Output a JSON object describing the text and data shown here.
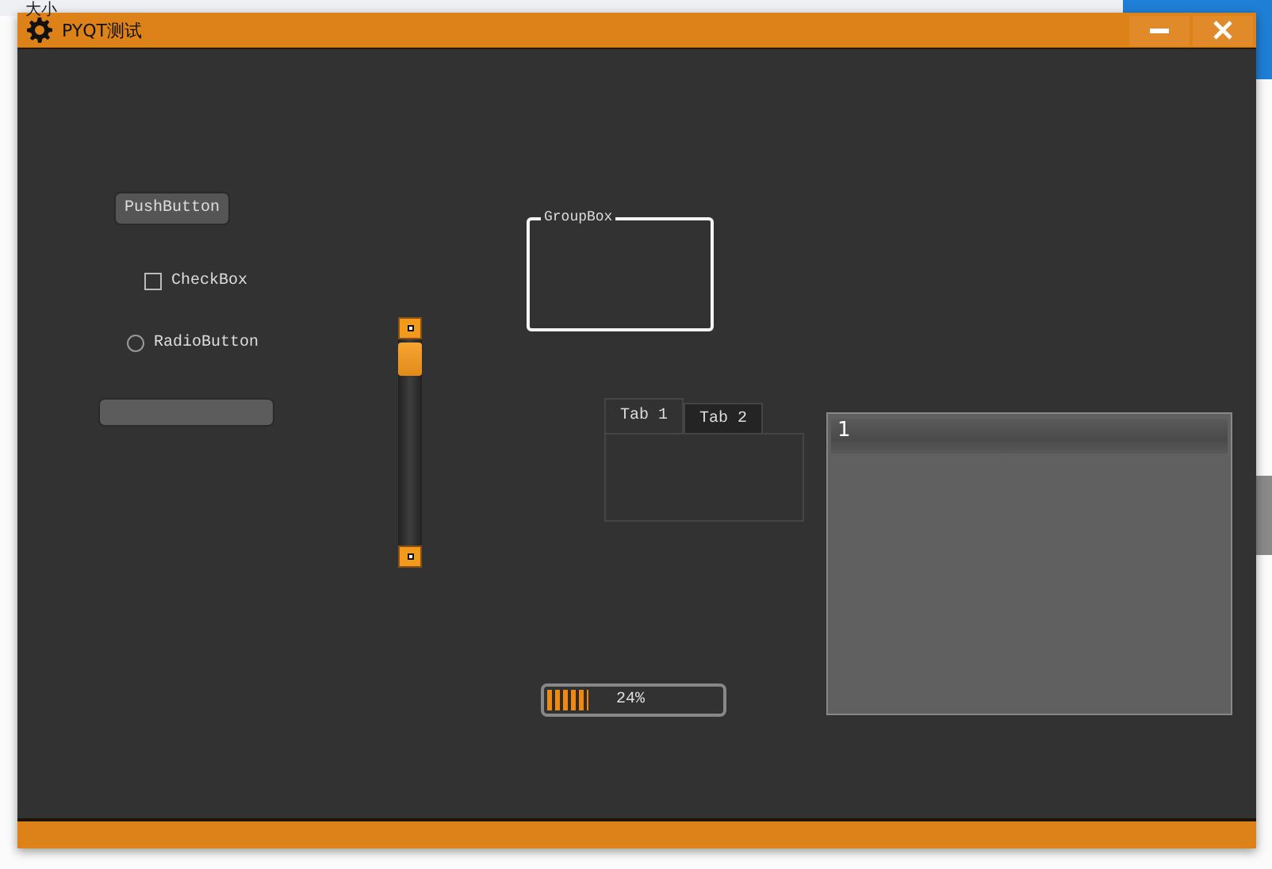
{
  "desktop": {
    "texts": [
      "大小"
    ]
  },
  "window": {
    "title": "PYQT测试"
  },
  "push_button": {
    "label": "PushButton"
  },
  "checkbox": {
    "label": "CheckBox",
    "checked": false
  },
  "radio_button": {
    "label": "RadioButton",
    "selected": false
  },
  "group_box": {
    "title": "GroupBox"
  },
  "tabs": [
    {
      "label": "Tab 1",
      "selected": true
    },
    {
      "label": "Tab 2",
      "selected": false
    }
  ],
  "progress": {
    "level": 0.24,
    "text": "24%"
  },
  "list": {
    "items": [
      {
        "text": "1",
        "selected": true
      }
    ]
  }
}
